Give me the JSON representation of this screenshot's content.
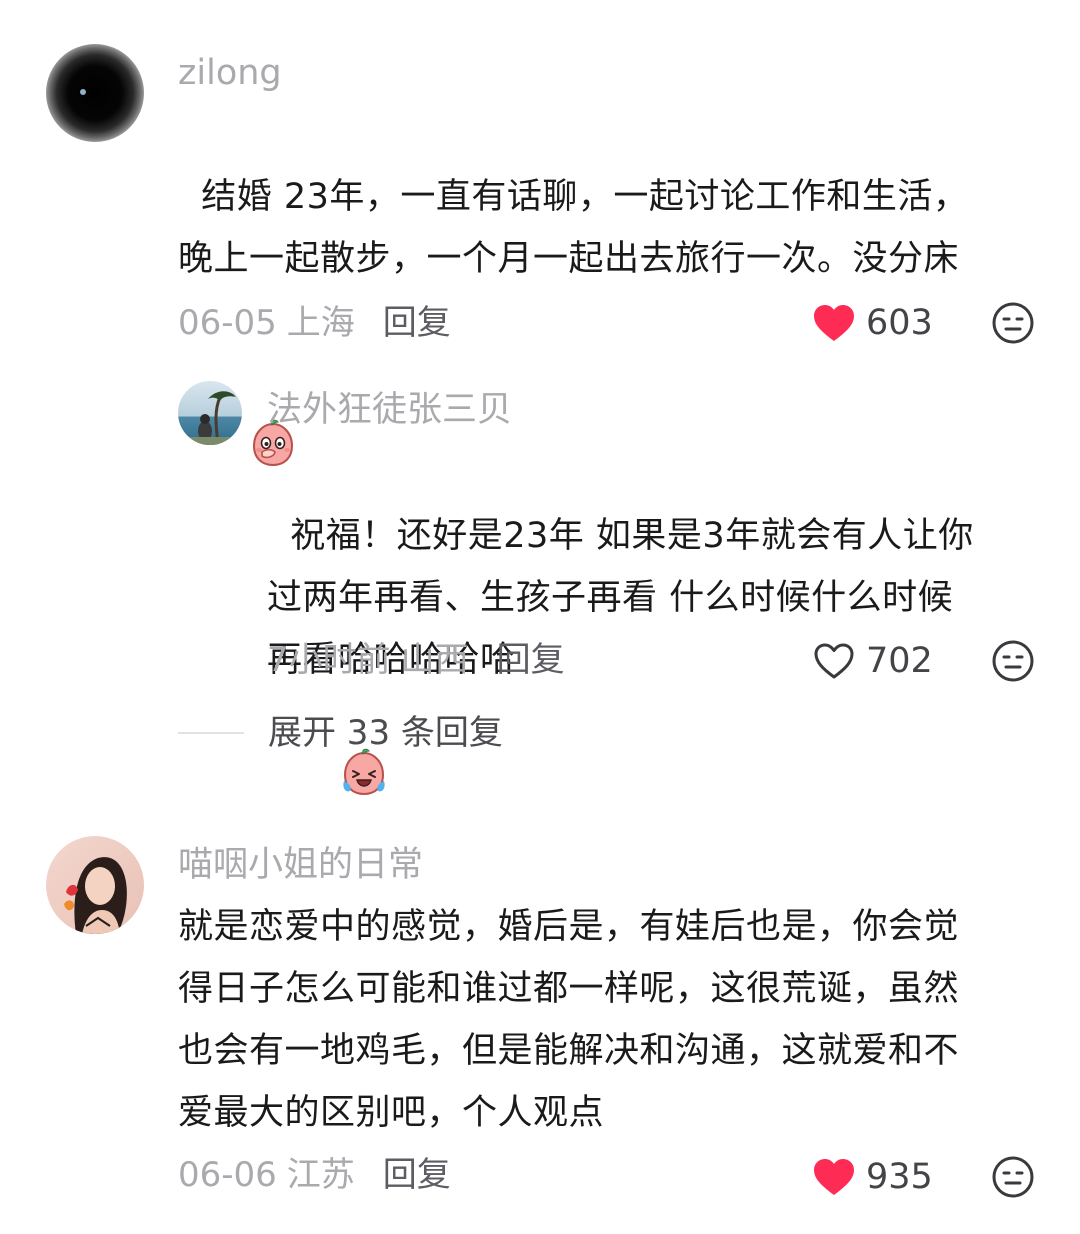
{
  "comments": [
    {
      "username": "zilong",
      "avatar_icon": "dark-tunnel-avatar",
      "text": "结婚 23年，一直有话聊，一起讨论工作和生活，\n晚上一起散步，一个月一起出去旅行一次。没分床",
      "emoji_icon": "peach-cover-mouth-emoji",
      "date": "06-05",
      "location": "上海",
      "reply_label": "回复",
      "likes": "603",
      "liked": true,
      "replies": [
        {
          "username": "法外狂徒张三贝",
          "avatar_icon": "seaside-tree-avatar",
          "text": "祝福！还好是23年 如果是3年就会有人让你\n过两年再看、生孩子再看 什么时候什么时候\n再看哈哈哈哈哈",
          "emoji_icon": "peach-laugh-cry-emoji",
          "date": "7小时前",
          "location": "山西",
          "reply_label": "回复",
          "likes": "702",
          "liked": false
        }
      ],
      "expand_label": "展开 33 条回复"
    },
    {
      "username": "喵咽小姐的日常",
      "avatar_icon": "woman-portrait-avatar",
      "text": "就是恋爱中的感觉，婚后是，有娃后也是，你会觉\n得日子怎么可能和谁过都一样呢，这很荒诞，虽然\n也会有一地鸡毛，但是能解决和沟通，这就爱和不\n爱最大的区别吧，个人观点",
      "date": "06-06",
      "location": "江苏",
      "reply_label": "回复",
      "likes": "935",
      "liked": true
    }
  ],
  "colors": {
    "like_red": "#fe2c55",
    "meta_gray": "#a9a9ae",
    "text_dark": "#1a1a1a"
  }
}
